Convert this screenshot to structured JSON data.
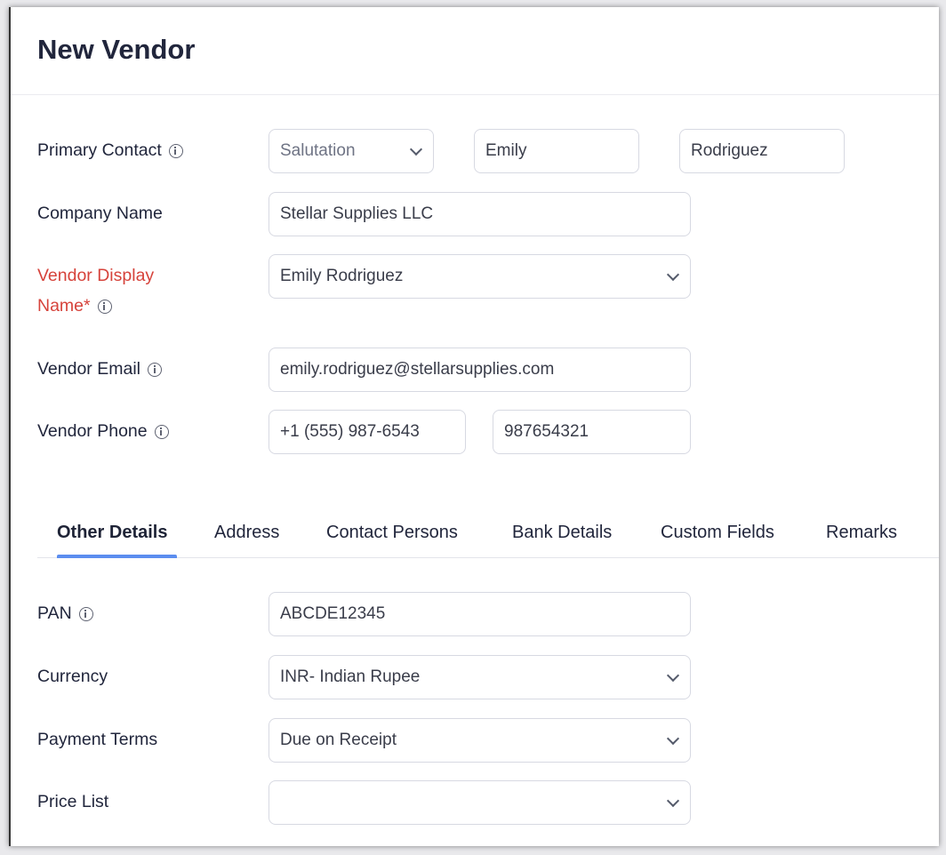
{
  "title": "New Vendor",
  "primary_contact": {
    "label": "Primary Contact",
    "salutation_placeholder": "Salutation",
    "first_name": "Emily",
    "last_name": "Rodriguez"
  },
  "company_name": {
    "label": "Company Name",
    "value": "Stellar Supplies LLC"
  },
  "display_name": {
    "label_line1": "Vendor Display",
    "label_line2": "Name*",
    "value": "Emily Rodriguez"
  },
  "email": {
    "label": "Vendor Email",
    "value": "emily.rodriguez@stellarsupplies.com"
  },
  "phone": {
    "label": "Vendor Phone",
    "work": "+1 (555) 987-6543",
    "mobile": "987654321"
  },
  "tabs": [
    {
      "label": "Other Details",
      "active": true
    },
    {
      "label": "Address"
    },
    {
      "label": "Contact Persons"
    },
    {
      "label": "Bank Details"
    },
    {
      "label": "Custom Fields"
    },
    {
      "label": "Remarks"
    }
  ],
  "other": {
    "pan": {
      "label": "PAN",
      "value": "ABCDE12345"
    },
    "currency": {
      "label": "Currency",
      "value": "INR- Indian Rupee"
    },
    "payment_terms": {
      "label": "Payment Terms",
      "value": "Due on Receipt"
    },
    "price_list": {
      "label": "Price List",
      "value": ""
    }
  }
}
